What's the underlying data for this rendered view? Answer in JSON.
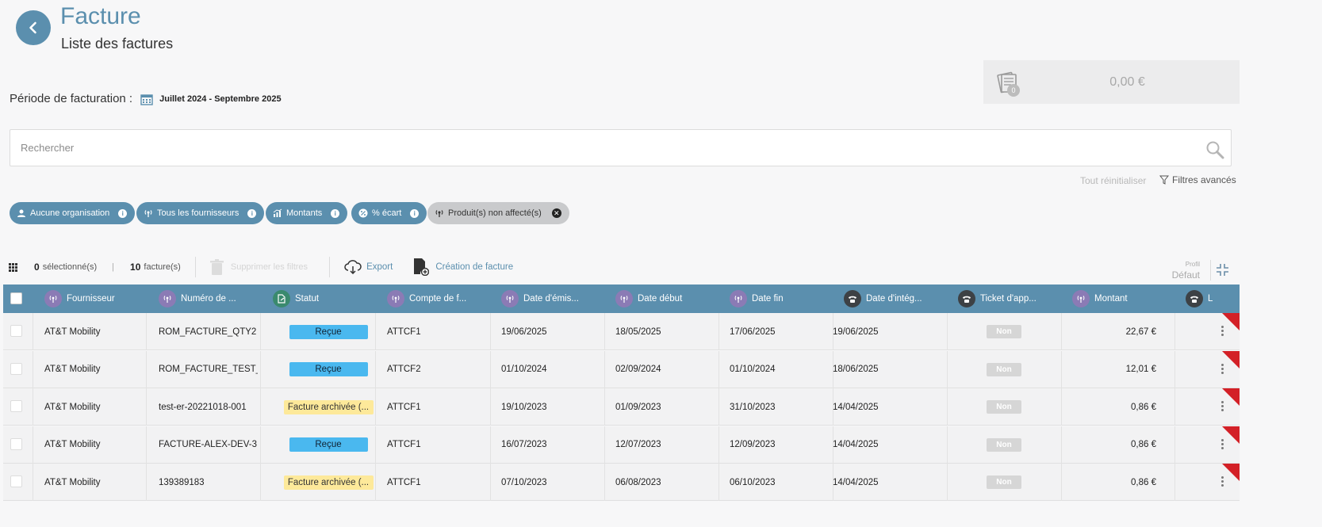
{
  "header": {
    "title": "Facture",
    "subtitle": "Liste des factures"
  },
  "period": {
    "label": "Période de facturation :",
    "value": "Juillet 2024 - Septembre 2025"
  },
  "total": {
    "count": "0",
    "amount": "0,00 €"
  },
  "search": {
    "placeholder": "Rechercher"
  },
  "filters": {
    "reset_label": "Tout réinitialiser",
    "advanced_label": "Filtres avancés",
    "chips": [
      {
        "label": "Aucune organisation"
      },
      {
        "label": "Tous les fournisseurs"
      },
      {
        "label": "Montants"
      },
      {
        "label": "% écart"
      },
      {
        "label": "Produit(s) non affecté(s)"
      }
    ]
  },
  "toolbar": {
    "selected_count": "0",
    "selected_label": "sélectionné(s)",
    "separator": "|",
    "invoice_count": "10",
    "invoice_label": "facture(s)",
    "delete_filters": "Supprimer les filtres",
    "export": "Export",
    "create_invoice": "Création de facture",
    "profile_label": "Profil",
    "profile_value": "Défaut"
  },
  "table": {
    "columns": [
      "Fournisseur",
      "Numéro de ...",
      "Statut",
      "Compte de f...",
      "Date d'émis...",
      "Date début",
      "Date fin",
      "Date d'intég...",
      "Ticket d'app...",
      "Montant",
      "L"
    ],
    "rows": [
      {
        "supplier": "AT&T Mobility",
        "number": "ROM_FACTURE_QTY2",
        "status": "Reçue",
        "account": "ATTCF1",
        "issue_date": "19/06/2025",
        "start_date": "18/05/2025",
        "end_date": "17/06/2025",
        "integration_date": "19/06/2025",
        "ticket": "Non",
        "amount": "22,67 €"
      },
      {
        "supplier": "AT&T Mobility",
        "number": "ROM_FACTURE_TEST_...",
        "status": "Reçue",
        "account": "ATTCF2",
        "issue_date": "01/10/2024",
        "start_date": "02/09/2024",
        "end_date": "01/10/2024",
        "integration_date": "18/06/2025",
        "ticket": "Non",
        "amount": "12,01 €"
      },
      {
        "supplier": "AT&T Mobility",
        "number": "test-er-20221018-001",
        "status": "Facture archivée (...",
        "account": "ATTCF1",
        "issue_date": "19/10/2023",
        "start_date": "01/09/2023",
        "end_date": "31/10/2023",
        "integration_date": "14/04/2025",
        "ticket": "Non",
        "amount": "0,86 €"
      },
      {
        "supplier": "AT&T Mobility",
        "number": "FACTURE-ALEX-DEV-3",
        "status": "Reçue",
        "account": "ATTCF1",
        "issue_date": "16/07/2023",
        "start_date": "12/07/2023",
        "end_date": "12/09/2023",
        "integration_date": "14/04/2025",
        "ticket": "Non",
        "amount": "0,86 €"
      },
      {
        "supplier": "AT&T Mobility",
        "number": "139389183",
        "status": "Facture archivée (...",
        "account": "ATTCF1",
        "issue_date": "07/10/2023",
        "start_date": "06/08/2023",
        "end_date": "06/10/2023",
        "integration_date": "14/04/2025",
        "ticket": "Non",
        "amount": "0,86 €"
      }
    ]
  },
  "colors": {
    "primary": "#5b8fae",
    "status_received": "#4ab8ef",
    "status_archived": "#fde99a",
    "alert_corner": "#d32027"
  }
}
